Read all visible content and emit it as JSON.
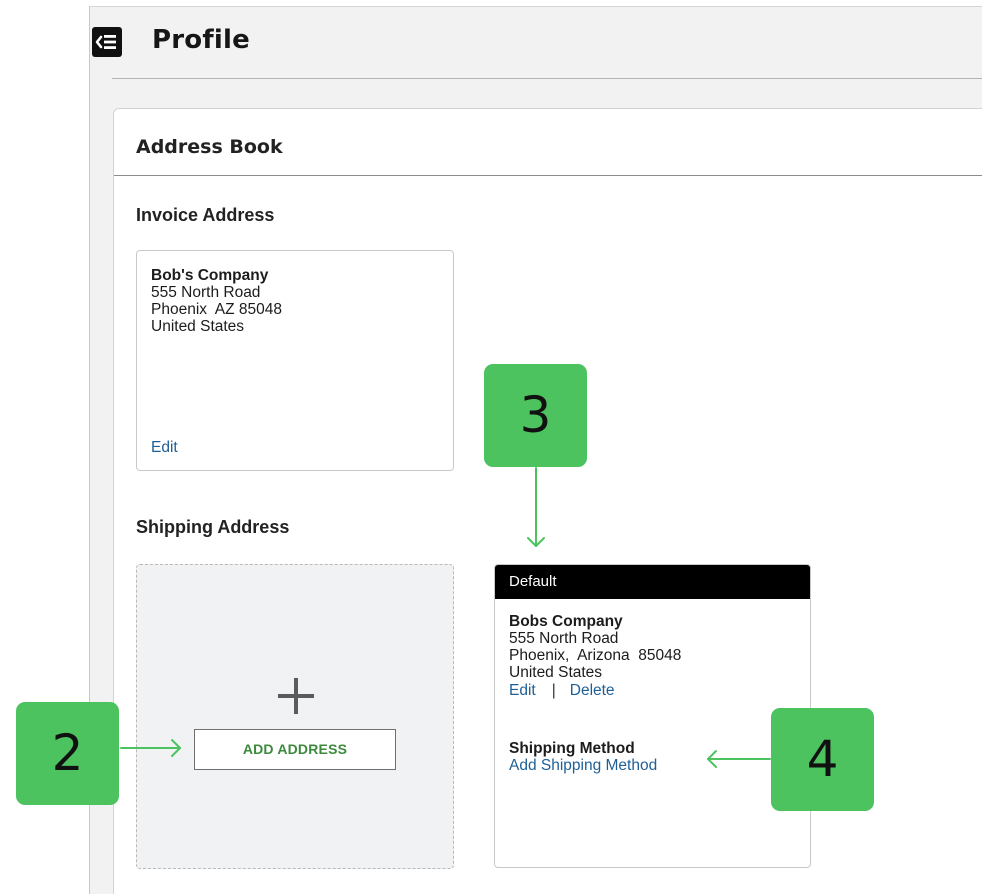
{
  "header": {
    "title": "Profile",
    "back_icon": "collapse-menu-icon"
  },
  "address_book": {
    "title": "Address Book",
    "invoice": {
      "section_title": "Invoice Address",
      "company": "Bob's Company",
      "street": "555 North Road",
      "city_line": "Phoenix  AZ 85048",
      "country": "United States",
      "edit_label": "Edit"
    },
    "shipping": {
      "section_title": "Shipping Address",
      "add_icon": "plus-icon",
      "add_button_label": "ADD ADDRESS",
      "default_card": {
        "badge": "Default",
        "company": "Bobs Company",
        "street": "555 North Road",
        "city_line": "Phoenix,  Arizona  85048",
        "country": "United States",
        "edit_label": "Edit",
        "separator": "|",
        "delete_label": "Delete",
        "method_title": "Shipping Method",
        "method_link": "Add Shipping Method"
      }
    }
  },
  "callouts": {
    "two": "2",
    "three": "3",
    "four": "4"
  },
  "colors": {
    "callout": "#4cc35f",
    "link": "#1e5f96",
    "add_button_text": "#3d8a3d",
    "default_bar": "#000000"
  }
}
